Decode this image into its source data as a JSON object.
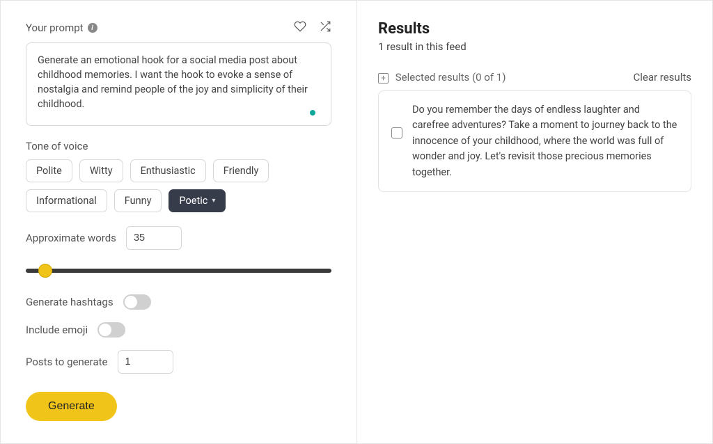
{
  "prompt": {
    "label": "Your prompt",
    "value": "Generate an emotional hook for a social media post about childhood memories. I want the hook to evoke a sense of nostalgia and remind people of the joy and simplicity of their childhood."
  },
  "tone": {
    "label": "Tone of voice",
    "options": [
      "Polite",
      "Witty",
      "Enthusiastic",
      "Friendly",
      "Informational",
      "Funny",
      "Poetic"
    ],
    "selected": "Poetic"
  },
  "approx_words": {
    "label": "Approximate words",
    "value": "35"
  },
  "hashtags": {
    "label": "Generate hashtags",
    "on": false
  },
  "emoji": {
    "label": "Include emoji",
    "on": false
  },
  "posts": {
    "label": "Posts to generate",
    "value": "1"
  },
  "generate_label": "Generate",
  "results": {
    "title": "Results",
    "subtitle": "1 result in this feed",
    "selected_label": "Selected results (0 of 1)",
    "clear_label": "Clear results",
    "items": [
      {
        "text": "Do you remember the days of endless laughter and carefree adventures? Take a moment to journey back to the innocence of your childhood, where the world was full of wonder and joy. Let's revisit those precious memories together."
      }
    ]
  }
}
